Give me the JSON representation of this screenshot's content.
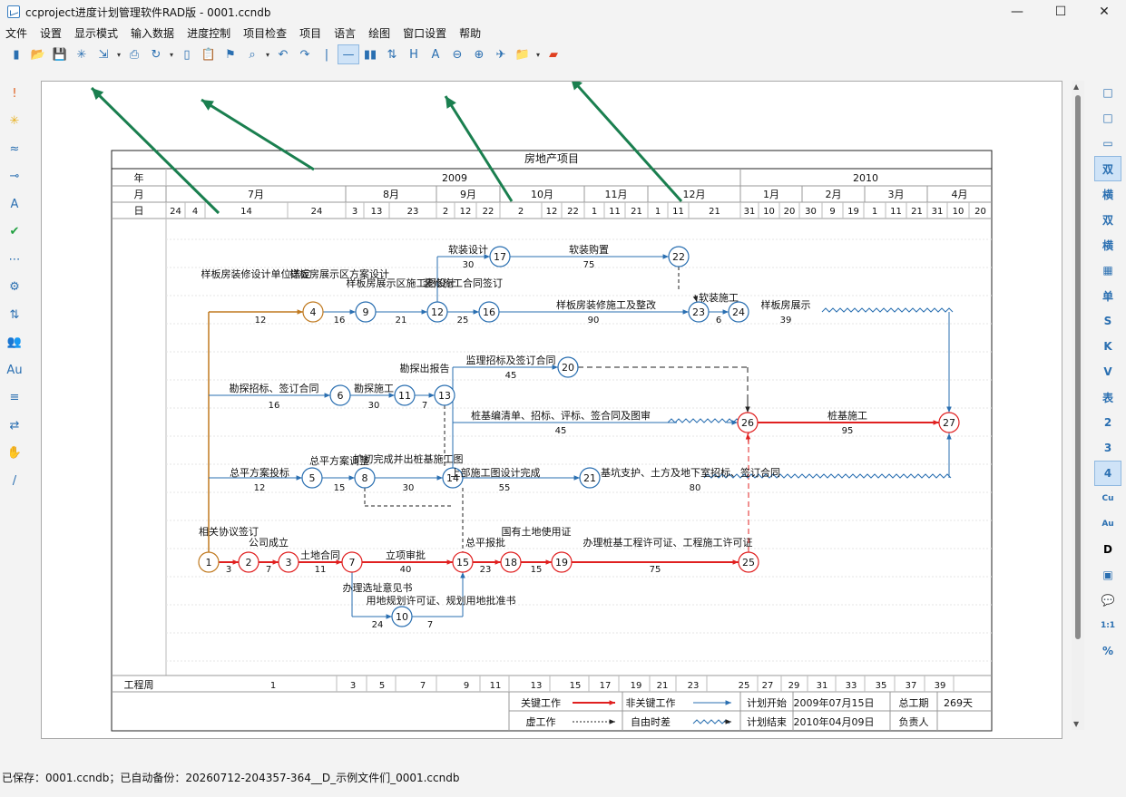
{
  "window": {
    "title": "ccproject进度计划管理软件RAD版 - 0001.ccndb",
    "minimize": "—",
    "maximize": "☐",
    "close": "✕"
  },
  "menu": [
    "文件",
    "设置",
    "显示模式",
    "输入数据",
    "进度控制",
    "项目检查",
    "项目",
    "语言",
    "绘图",
    "窗口设置",
    "帮助"
  ],
  "toolbar_icons": [
    "new-icon",
    "open-icon",
    "save-icon",
    "star-icon",
    "export-icon",
    "dropdown-icon",
    "print-icon",
    "refresh-icon",
    "dropdown-icon",
    "copy-icon",
    "paste-icon",
    "format-brush-icon",
    "search-icon",
    "dropdown-icon",
    "undo-icon",
    "redo-icon",
    "separator-icon",
    "line-icon",
    "bar-icon",
    "sort-icon",
    "h-icon",
    "text-a-icon",
    "zoom-out-icon",
    "zoom-in-icon",
    "plane-icon",
    "folder-icon",
    "dropdown-icon",
    "folder-red-icon"
  ],
  "left_tools": [
    "alert-icon",
    "star-icon",
    "wave-icon",
    "link-icon",
    "font-icon",
    "check-icon",
    "dots-icon",
    "gear-icon",
    "sort-icon",
    "users-icon",
    "au-icon",
    "filter-icon",
    "swap-icon",
    "hand-icon",
    "wand-icon"
  ],
  "right_tools": [
    "□",
    "□",
    "▭",
    "双",
    "横",
    "双",
    "横",
    "▦",
    "单",
    "S",
    "K",
    "V",
    "表",
    "2",
    "3",
    "4",
    "Cu",
    "Au",
    "D",
    "▣",
    "💬",
    "1:1",
    "%"
  ],
  "chart": {
    "title": "房地产项目",
    "row_labels": {
      "year": "年",
      "month": "月",
      "day": "日",
      "week": "工程周"
    },
    "years": [
      {
        "label": "2009"
      },
      {
        "label": "2010"
      }
    ],
    "months": [
      "7月",
      "8月",
      "9月",
      "10月",
      "11月",
      "12月",
      "1月",
      "2月",
      "3月",
      "4月"
    ],
    "days": [
      "24",
      "4",
      "14",
      "24",
      "3",
      "13",
      "23",
      "2",
      "12",
      "22",
      "2",
      "12",
      "22",
      "1",
      "11",
      "21",
      "1",
      "11",
      "21",
      "31",
      "10",
      "20",
      "30",
      "9",
      "19",
      "1",
      "11",
      "21",
      "31",
      "10",
      "20"
    ],
    "weeks": [
      "1",
      "3",
      "5",
      "7",
      "9",
      "11",
      "13",
      "15",
      "17",
      "19",
      "21",
      "23",
      "25",
      "27",
      "29",
      "31",
      "33",
      "35",
      "37",
      "39"
    ],
    "nodes": [
      "1",
      "2",
      "3",
      "4",
      "5",
      "6",
      "7",
      "8",
      "9",
      "10",
      "11",
      "12",
      "13",
      "14",
      "15",
      "16",
      "17",
      "18",
      "19",
      "20",
      "21",
      "22",
      "23",
      "24",
      "25",
      "26",
      "27"
    ],
    "activities": [
      {
        "name": "相关协议签订",
        "dur": "3"
      },
      {
        "name": "公司成立",
        "dur": "7"
      },
      {
        "name": "土地合同",
        "dur": "11"
      },
      {
        "name": "立项审批",
        "dur": "40"
      },
      {
        "name": "总平报批",
        "dur": "23"
      },
      {
        "name": "国有土地使用证",
        "dur": "15"
      },
      {
        "name": "办理桩基工程许可证、工程施工许可证",
        "dur": "75"
      },
      {
        "name": "办理选址意见书",
        "dur": "24"
      },
      {
        "name": "用地规划许可证、规划用地批准书",
        "dur": "7"
      },
      {
        "name": "总平方案投标",
        "dur": "12"
      },
      {
        "name": "总平方案调整",
        "dur": "15"
      },
      {
        "name": "扩初完成并出桩基施工图",
        "dur": "30"
      },
      {
        "name": "上部施工图设计完成",
        "dur": "55"
      },
      {
        "name": "基坑支护、土方及地下室招标、签订合同",
        "dur": "80"
      },
      {
        "name": "勘探招标、签订合同",
        "dur": "16"
      },
      {
        "name": "勘探施工",
        "dur": "30"
      },
      {
        "name": "勘探出报告",
        "dur": "7"
      },
      {
        "name": "监理招标及签订合同",
        "dur": "45"
      },
      {
        "name": "桩基编清单、招标、评标、签合同及图审",
        "dur": "45"
      },
      {
        "name": "桩基施工",
        "dur": "95"
      },
      {
        "name": "样板房装修设计单位选定",
        "dur": "12"
      },
      {
        "name": "样板房展示区方案设计",
        "dur": "16"
      },
      {
        "name": "样板房展示区施工图设计",
        "dur": "21"
      },
      {
        "name": "装修施工合同签订",
        "dur": "25"
      },
      {
        "name": "软装设计",
        "dur": "30"
      },
      {
        "name": "软装购置",
        "dur": "75"
      },
      {
        "name": "样板房装修施工及整改",
        "dur": "90"
      },
      {
        "name": "软装施工",
        "dur": "6"
      },
      {
        "name": "样板房展示",
        "dur": "39"
      }
    ],
    "legend": {
      "critical": "关键工作",
      "noncritical": "非关键工作",
      "dummy": "虚工作",
      "float": "自由时差",
      "plan_start_label": "计划开始",
      "plan_start": "2009年07月15日",
      "plan_end_label": "计划结束",
      "plan_end": "2010年04月09日",
      "duration_label": "总工期",
      "duration": "269天",
      "owner_label": "负责人"
    }
  },
  "status": "已保存：0001.ccndb；已自动备份：20260712-204357-364__D_示例文件们_0001.ccndb",
  "colors": {
    "critical": "#e02020",
    "noncritical": "#2a6fb1",
    "highlight": "#c07a20",
    "annotation": "#1a7f4f"
  }
}
